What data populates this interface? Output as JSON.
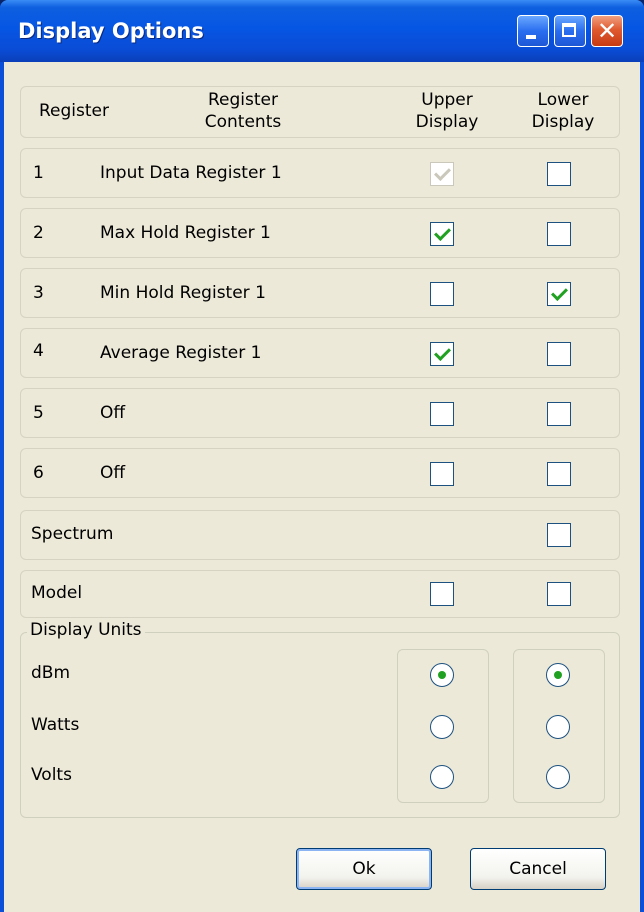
{
  "window": {
    "title": "Display Options"
  },
  "header": {
    "register": "Register",
    "contents_line1": "Register",
    "contents_line2": "Contents",
    "upper_line1": "Upper",
    "upper_line2": "Display",
    "lower_line1": "Lower",
    "lower_line2": "Display"
  },
  "rows": [
    {
      "register": "1",
      "contents": "Input Data Register 1",
      "upper": true,
      "upper_disabled": true,
      "lower": false
    },
    {
      "register": "2",
      "contents": "Max Hold Register 1",
      "upper": true,
      "lower": false
    },
    {
      "register": "3",
      "contents": "Min Hold Register 1",
      "upper": false,
      "lower": true
    },
    {
      "register": "4",
      "contents": "Average Register 1",
      "upper": true,
      "lower": false
    },
    {
      "register": "5",
      "contents": "Off",
      "upper": false,
      "lower": false
    },
    {
      "register": "6",
      "contents": "Off",
      "upper": false,
      "lower": false
    }
  ],
  "spectrum": {
    "label": "Spectrum",
    "lower": false
  },
  "model": {
    "label": "Model",
    "upper": false,
    "lower": false
  },
  "display_units": {
    "legend": "Display Units",
    "options": [
      "dBm",
      "Watts",
      "Volts"
    ],
    "upper_selected": "dBm",
    "lower_selected": "dBm"
  },
  "buttons": {
    "ok": "Ok",
    "cancel": "Cancel"
  },
  "colors": {
    "titlebar": "#0656e4",
    "check_green": "#21a121",
    "client_bg": "#ece9d8"
  }
}
